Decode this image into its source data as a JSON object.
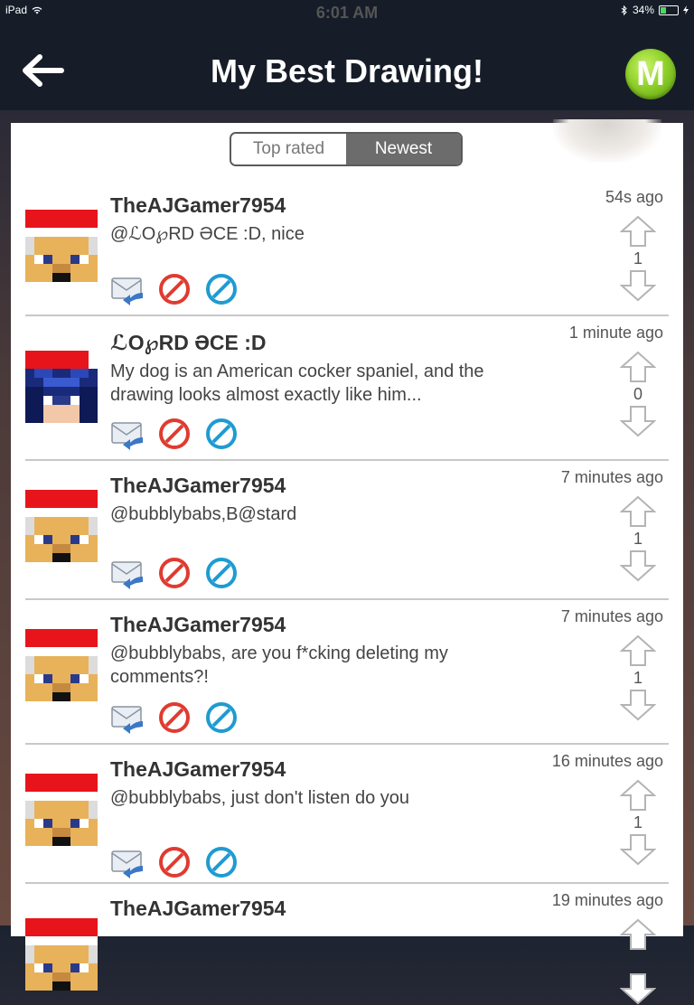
{
  "status": {
    "device": "iPad",
    "time": "6:01 AM",
    "battery": "34%",
    "battery_level": 0.34
  },
  "nav": {
    "title": "My Best Drawing!",
    "logo_letter": "M"
  },
  "tabs": {
    "top_rated": "Top rated",
    "newest": "Newest",
    "active": "newest"
  },
  "comments": [
    {
      "user": "TheAJGamer7954",
      "text": "@ℒΟ℘RD ƏCE :D, nice",
      "time": "54s ago",
      "votes": "1",
      "avatar": "santa"
    },
    {
      "user": "ℒΟ℘RD ƏCE :D",
      "text": "My dog is an American cocker spaniel, and the drawing looks almost exactly like him...",
      "time": "1 minute ago",
      "votes": "0",
      "avatar": "bluehair"
    },
    {
      "user": "TheAJGamer7954",
      "text": "@bubblybabs,B@stard",
      "time": "7 minutes ago",
      "votes": "1",
      "avatar": "santa"
    },
    {
      "user": "TheAJGamer7954",
      "text": "@bubblybabs, are you f*cking deleting my comments?!",
      "time": "7 minutes ago",
      "votes": "1",
      "avatar": "santa"
    },
    {
      "user": "TheAJGamer7954",
      "text": "@bubblybabs, just don't listen do you",
      "time": "16 minutes ago",
      "votes": "1",
      "avatar": "santa"
    },
    {
      "user": "TheAJGamer7954",
      "text": "",
      "time": "19 minutes ago",
      "votes": "",
      "avatar": "santa"
    }
  ],
  "colors": {
    "nav_bg": "#161d29",
    "logo_green": "#8fd12a",
    "block_red": "#e03b30",
    "block_blue": "#1f9bd1",
    "reply_blue": "#3a78c8"
  }
}
